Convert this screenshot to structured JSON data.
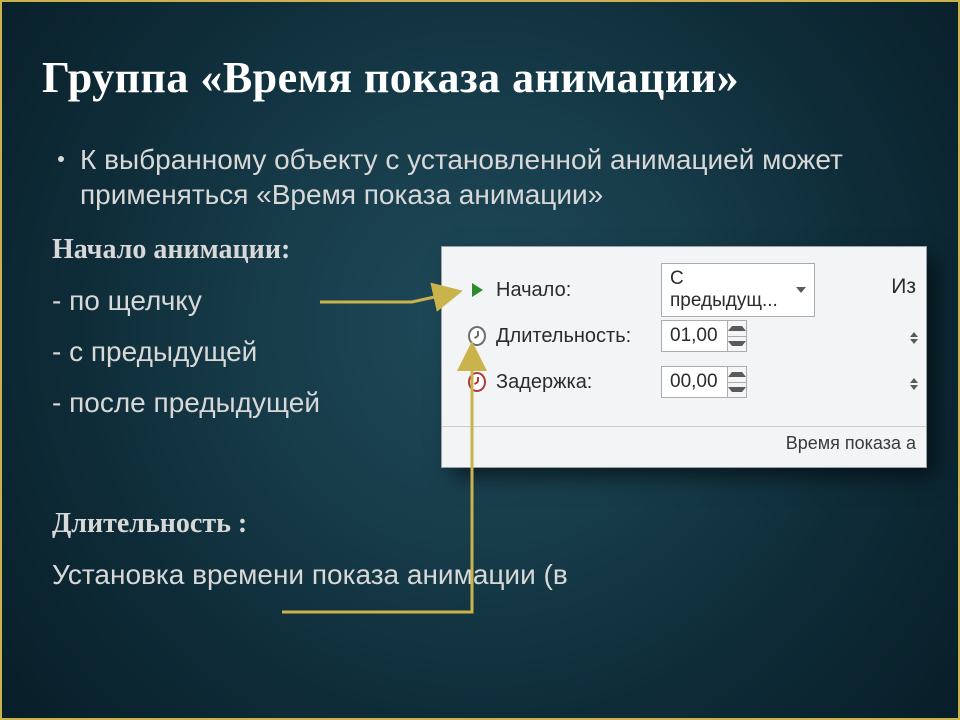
{
  "title": "Группа «Время показа анимации»",
  "bullet_text": "К выбранному объекту с установленной анимацией может применяться «Время показа анимации»",
  "section_start": "Начало анимации:",
  "opt1": "- по щелчку",
  "opt2": "- с предыдущей",
  "opt3": "- после предыдущей",
  "section_duration": "Длительность :",
  "duration_text": "Установка времени показа анимации (в",
  "panel": {
    "edge_label": "Из",
    "caption": "Время показа а",
    "rows": {
      "start": {
        "label": "Начало:",
        "value": "С предыдущ..."
      },
      "duration": {
        "label": "Длительность:",
        "value": "01,00"
      },
      "delay": {
        "label": "Задержка:",
        "value": "00,00"
      }
    }
  }
}
